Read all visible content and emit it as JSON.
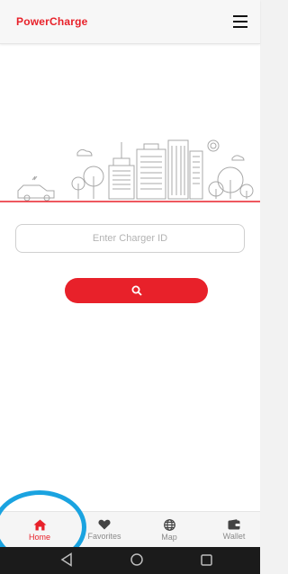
{
  "app": {
    "brand": "PowerCharge",
    "brand_color": "#e8212a"
  },
  "header": {
    "menu_icon": "hamburger-menu-icon"
  },
  "search": {
    "placeholder": "Enter Charger ID",
    "value": "",
    "button_icon": "search-icon"
  },
  "bottom_nav": {
    "items": [
      {
        "label": "Home",
        "icon": "home-icon",
        "active": true
      },
      {
        "label": "Favorites",
        "icon": "heart-icon",
        "active": false
      },
      {
        "label": "Map",
        "icon": "globe-icon",
        "active": false
      },
      {
        "label": "Wallet",
        "icon": "wallet-icon",
        "active": false
      }
    ]
  },
  "system_nav": {
    "back_icon": "back-triangle-icon",
    "home_icon": "home-circle-icon",
    "recents_icon": "recents-square-icon"
  },
  "colors": {
    "accent": "#e8212a",
    "highlight_ring": "#1aa3e0"
  }
}
